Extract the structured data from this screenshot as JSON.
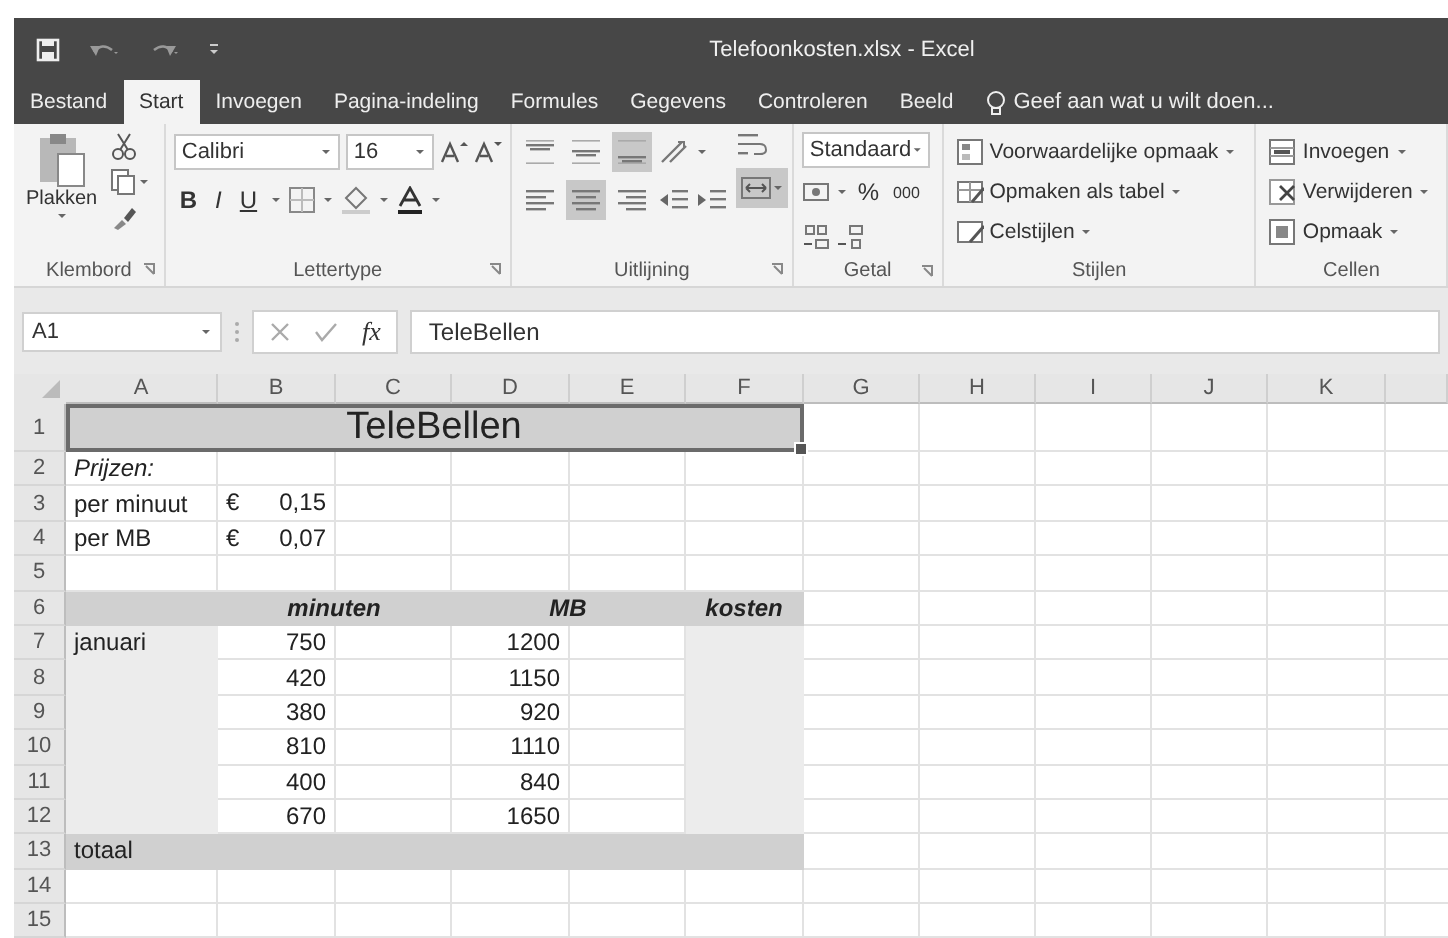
{
  "window": {
    "title": "Telefoonkosten.xlsx - Excel"
  },
  "tabs": [
    {
      "label": "Bestand",
      "selected": false
    },
    {
      "label": "Start",
      "selected": true
    },
    {
      "label": "Invoegen",
      "selected": false
    },
    {
      "label": "Pagina-indeling",
      "selected": false
    },
    {
      "label": "Formules",
      "selected": false
    },
    {
      "label": "Gegevens",
      "selected": false
    },
    {
      "label": "Controleren",
      "selected": false
    },
    {
      "label": "Beeld",
      "selected": false
    }
  ],
  "tell_me": {
    "placeholder": "Geef aan wat u wilt doen..."
  },
  "ribbon": {
    "clipboard": {
      "label": "Klembord",
      "paste": "Plakken"
    },
    "font": {
      "label": "Lettertype",
      "font_name": "Calibri",
      "font_size": "16",
      "bold": "B",
      "italic": "I",
      "underline": "U"
    },
    "alignment": {
      "label": "Uitlijning",
      "vertical": [
        {
          "selected": false
        },
        {
          "selected": false
        },
        {
          "selected": true
        }
      ],
      "horizontal": [
        {
          "selected": false
        },
        {
          "selected": true
        },
        {
          "selected": false
        }
      ],
      "merge_selected": true
    },
    "number": {
      "label": "Getal",
      "format": "Standaard",
      "percent": "%",
      "thousands": "000"
    },
    "styles": {
      "label": "Stijlen",
      "items": [
        "Voorwaardelijke opmaak",
        "Opmaken als tabel",
        "Celstijlen"
      ]
    },
    "cells": {
      "label": "Cellen",
      "items": [
        "Invoegen",
        "Verwijderen",
        "Opmaak"
      ]
    }
  },
  "formula_bar": {
    "name_box": "A1",
    "fx": "fx",
    "value": "TeleBellen"
  },
  "sheet": {
    "columns": [
      "A",
      "B",
      "C",
      "D",
      "E",
      "F",
      "G",
      "H",
      "I",
      "J",
      "K"
    ],
    "rows": [
      {
        "number": "1",
        "kind": "title",
        "selected": true,
        "cells": [
          "TeleBellen"
        ]
      },
      {
        "number": "2",
        "kind": "note",
        "cells": [
          "Prijzen:"
        ]
      },
      {
        "number": "3",
        "kind": "price",
        "cells": [
          "per minuut",
          "€ 0,15"
        ]
      },
      {
        "number": "4",
        "kind": "price",
        "cells": [
          "per MB",
          "€ 0,07"
        ]
      },
      {
        "number": "5",
        "kind": "blank"
      },
      {
        "number": "6",
        "kind": "header",
        "cells": [
          "",
          "minuten",
          "",
          "MB",
          "",
          "kosten"
        ]
      },
      {
        "number": "7",
        "kind": "data",
        "cells": [
          "januari",
          "750",
          "",
          "1200"
        ]
      },
      {
        "number": "8",
        "kind": "data",
        "cells": [
          "",
          "420",
          "",
          "1150"
        ]
      },
      {
        "number": "9",
        "kind": "data",
        "cells": [
          "",
          "380",
          "",
          "920"
        ]
      },
      {
        "number": "10",
        "kind": "data",
        "cells": [
          "",
          "810",
          "",
          "1110"
        ]
      },
      {
        "number": "11",
        "kind": "data",
        "cells": [
          "",
          "400",
          "",
          "840"
        ]
      },
      {
        "number": "12",
        "kind": "data",
        "cells": [
          "",
          "670",
          "",
          "1650"
        ]
      },
      {
        "number": "13",
        "kind": "total",
        "cells": [
          "totaal"
        ]
      },
      {
        "number": "14",
        "kind": "blank"
      },
      {
        "number": "15",
        "kind": "blank"
      }
    ]
  }
}
